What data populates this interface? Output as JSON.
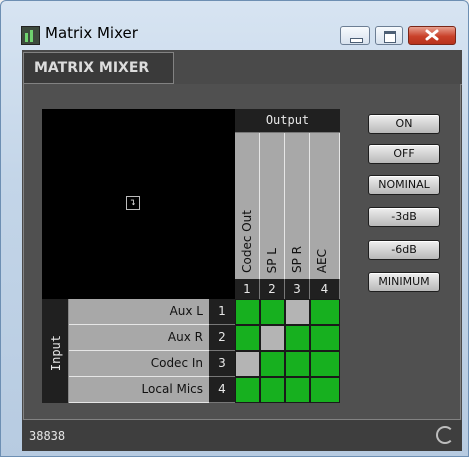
{
  "window": {
    "title": "Matrix Mixer"
  },
  "tab": {
    "label": "MATRIX MIXER"
  },
  "matrix": {
    "corner_symbol": "↴",
    "output_header": "Output",
    "input_header": "Input",
    "columns": [
      {
        "label": "Codec Out",
        "number": "1"
      },
      {
        "label": "SP L",
        "number": "2"
      },
      {
        "label": "SP R",
        "number": "3"
      },
      {
        "label": "AEC",
        "number": "4"
      }
    ],
    "rows": [
      {
        "label": "Aux L",
        "number": "1",
        "cells": [
          "on",
          "on",
          "off",
          "on"
        ]
      },
      {
        "label": "Aux R",
        "number": "2",
        "cells": [
          "on",
          "off",
          "on",
          "on"
        ]
      },
      {
        "label": "Codec In",
        "number": "3",
        "cells": [
          "off",
          "on",
          "on",
          "on"
        ]
      },
      {
        "label": "Local Mics",
        "number": "4",
        "cells": [
          "on",
          "on",
          "on",
          "on"
        ]
      }
    ],
    "on_color": "#17b01f",
    "off_color": "#b4b4b4"
  },
  "buttons": [
    {
      "label": "ON"
    },
    {
      "label": "OFF"
    },
    {
      "label": "NOMINAL"
    },
    {
      "label": "-3dB"
    },
    {
      "label": "-6dB"
    },
    {
      "label": "MINIMUM"
    }
  ],
  "status": {
    "text": "38838"
  }
}
